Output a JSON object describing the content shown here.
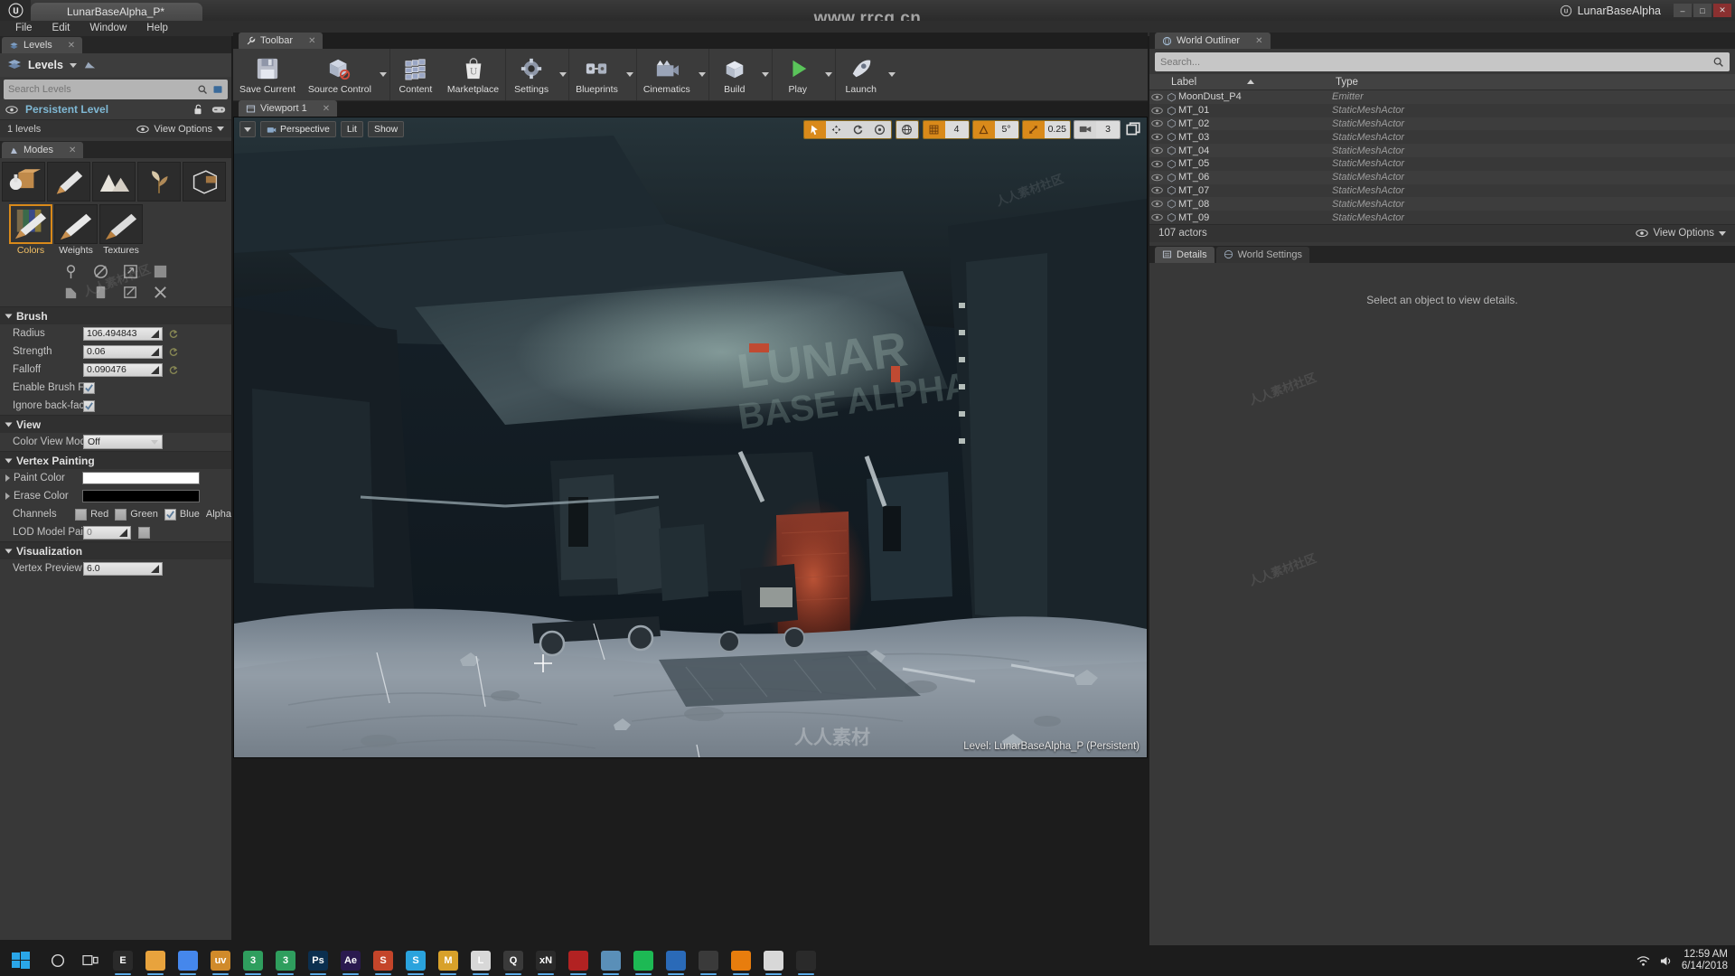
{
  "titlebar": {
    "project_tab": "LunarBaseAlpha_P*",
    "project_name": "LunarBaseAlpha",
    "min": "–",
    "max": "□",
    "close": "✕"
  },
  "menubar": {
    "items": [
      "File",
      "Edit",
      "Window",
      "Help"
    ]
  },
  "watermark": {
    "top": "www.rrcg.cn",
    "bottom": "人人素材"
  },
  "levels": {
    "tab": "Levels",
    "title": "Levels",
    "search_placeholder": "Search Levels",
    "search_value": "",
    "rows": [
      {
        "name": "Persistent Level"
      }
    ],
    "footer_count": "1 levels",
    "view_options": "View Options"
  },
  "modes": {
    "tab": "Modes",
    "mode_icons": [
      "place-mode-icon",
      "paint-mode-icon",
      "landscape-mode-icon",
      "foliage-mode-icon",
      "geometry-mode-icon"
    ],
    "brush_tabs": [
      {
        "label": "Colors",
        "active": true
      },
      {
        "label": "Weights",
        "active": false
      },
      {
        "label": "Textures",
        "active": false
      }
    ],
    "tool_icons": [
      "fill-icon",
      "no-paint-icon",
      "propagate-icon",
      "copy-icon",
      "paste-icon",
      "remove-icon",
      "import-icon",
      "fix-icon"
    ]
  },
  "brush_section": {
    "title": "Brush",
    "radius_label": "Radius",
    "radius_value": "106.494843",
    "strength_label": "Strength",
    "strength_value": "0.06",
    "falloff_label": "Falloff",
    "falloff_value": "0.090476",
    "enable_flow_label": "Enable Brush Flow",
    "enable_flow_checked": true,
    "ignore_back_label": "Ignore back-facing",
    "ignore_back_checked": true
  },
  "view_section": {
    "title": "View",
    "color_view_mode_label": "Color View Mode",
    "color_view_mode_value": "Off"
  },
  "vertex_painting": {
    "title": "Vertex Painting",
    "paint_color_label": "Paint Color",
    "paint_color_value": "#ffffff",
    "erase_color_label": "Erase Color",
    "erase_color_value": "#000000",
    "channels_label": "Channels",
    "channels": [
      {
        "label": "Red",
        "checked": false
      },
      {
        "label": "Green",
        "checked": false
      },
      {
        "label": "Blue",
        "checked": true
      },
      {
        "label": "Alpha",
        "checked": false
      }
    ],
    "lod_label": "LOD Model Paint",
    "lod_value": "0"
  },
  "visualization": {
    "title": "Visualization",
    "vertex_preview_label": "Vertex Preview S",
    "vertex_preview_value": "6.0"
  },
  "toolbar": {
    "tab": "Toolbar",
    "buttons": [
      {
        "label": "Save Current",
        "icon": "save-icon",
        "caret": false
      },
      {
        "label": "Source Control",
        "icon": "source-control-icon",
        "caret": true
      },
      {
        "label": "Content",
        "icon": "content-browser-icon",
        "caret": false
      },
      {
        "label": "Marketplace",
        "icon": "marketplace-icon",
        "caret": false
      },
      {
        "label": "Settings",
        "icon": "settings-gear-icon",
        "caret": true
      },
      {
        "label": "Blueprints",
        "icon": "blueprints-icon",
        "caret": true
      },
      {
        "label": "Cinematics",
        "icon": "cinematics-icon",
        "caret": true
      },
      {
        "label": "Build",
        "icon": "build-icon",
        "caret": true
      },
      {
        "label": "Play",
        "icon": "play-icon",
        "caret": true
      },
      {
        "label": "Launch",
        "icon": "launch-icon",
        "caret": true
      }
    ]
  },
  "viewport": {
    "tab": "Viewport 1",
    "perspective_label": "Perspective",
    "lit_label": "Lit",
    "show_label": "Show",
    "grid_snap_value": "4",
    "rotation_snap_value": "5°",
    "scale_snap_value": "0.25",
    "camera_speed_value": "3",
    "status": "Level: LunarBaseAlpha_P (Persistent)"
  },
  "world_outliner": {
    "tab": "World Outliner",
    "search_placeholder": "Search...",
    "search_value": "",
    "col_label": "Label",
    "col_type": "Type",
    "rows": [
      {
        "label": "MoonDust_P4",
        "type": "Emitter"
      },
      {
        "label": "MT_01",
        "type": "StaticMeshActor"
      },
      {
        "label": "MT_02",
        "type": "StaticMeshActor"
      },
      {
        "label": "MT_03",
        "type": "StaticMeshActor"
      },
      {
        "label": "MT_04",
        "type": "StaticMeshActor"
      },
      {
        "label": "MT_05",
        "type": "StaticMeshActor"
      },
      {
        "label": "MT_06",
        "type": "StaticMeshActor"
      },
      {
        "label": "MT_07",
        "type": "StaticMeshActor"
      },
      {
        "label": "MT_08",
        "type": "StaticMeshActor"
      },
      {
        "label": "MT_09",
        "type": "StaticMeshActor"
      }
    ],
    "footer_count": "107 actors",
    "view_options": "View Options"
  },
  "details": {
    "tabs": [
      {
        "label": "Details",
        "active": true
      },
      {
        "label": "World Settings",
        "active": false
      }
    ],
    "empty_message": "Select an object to view details."
  },
  "taskbar": {
    "start_label": "start-icon",
    "items": [
      {
        "name": "cortana-search-icon",
        "text": "",
        "color": "#1c1c1c"
      },
      {
        "name": "task-view-icon",
        "text": "",
        "color": "#1c1c1c"
      },
      {
        "name": "epic-games-icon",
        "text": "E",
        "color": "#2a2a2a"
      },
      {
        "name": "file-explorer-icon",
        "text": "",
        "color": "#e8a33d"
      },
      {
        "name": "chrome-icon",
        "text": "",
        "color": "#4587ec"
      },
      {
        "name": "uv-layout-icon",
        "text": "uv",
        "color": "#d08a2a"
      },
      {
        "name": "3dsmax-2018-icon",
        "text": "3",
        "color": "#2f9e5e"
      },
      {
        "name": "3dsmax-2019-icon",
        "text": "3",
        "color": "#2f9e5e"
      },
      {
        "name": "photoshop-icon",
        "text": "Ps",
        "color": "#0b2f4f"
      },
      {
        "name": "after-effects-icon",
        "text": "Ae",
        "color": "#2a1a4f"
      },
      {
        "name": "substance-icon",
        "text": "S",
        "color": "#c4452a"
      },
      {
        "name": "skype-icon",
        "text": "S",
        "color": "#2aa3dd"
      },
      {
        "name": "marmoset-icon",
        "text": "M",
        "color": "#d8a12a"
      },
      {
        "name": "marvelous-designer-icon",
        "text": "L",
        "color": "#d8d8d8"
      },
      {
        "name": "quixel-icon",
        "text": "Q",
        "color": "#3a3a3a"
      },
      {
        "name": "xnormal-icon",
        "text": "xN",
        "color": "#2a2a2a"
      },
      {
        "name": "zbrush-icon",
        "text": "",
        "color": "#b22222"
      },
      {
        "name": "designer-icon",
        "text": "",
        "color": "#5a8fb8"
      },
      {
        "name": "spotify-icon",
        "text": "",
        "color": "#1db954"
      },
      {
        "name": "browser-icon",
        "text": "",
        "color": "#2a6ab8"
      },
      {
        "name": "terminal-icon",
        "text": "",
        "color": "#3a3a3a"
      },
      {
        "name": "blender-icon",
        "text": "",
        "color": "#e87d0d"
      },
      {
        "name": "notes-icon",
        "text": "",
        "color": "#d8d8d8"
      },
      {
        "name": "unreal-engine-icon",
        "text": "",
        "color": "#2a2a2a"
      }
    ],
    "tray": {
      "icons": [
        "network-icon",
        "volume-icon"
      ],
      "time": "12:59 AM",
      "date": "6/14/2018"
    }
  }
}
